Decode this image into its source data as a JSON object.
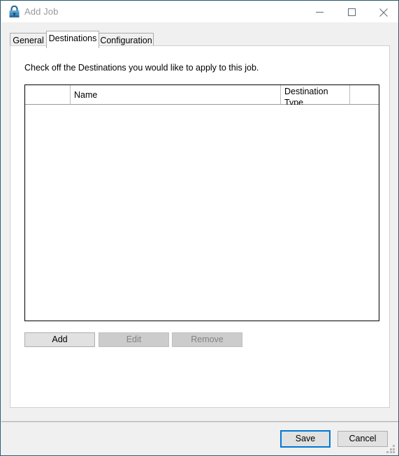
{
  "window": {
    "title": "Add Job",
    "icon": "padlock-icon",
    "accent_border": "#2b5f73",
    "controls": {
      "minimize": "minimize-icon",
      "maximize": "maximize-icon",
      "close": "close-icon"
    }
  },
  "tabs": [
    {
      "label": "General",
      "selected": false
    },
    {
      "label": "Destinations",
      "selected": true
    },
    {
      "label": "Configuration",
      "selected": false
    }
  ],
  "panel": {
    "instruction": "Check off the Destinations you would like to apply to this job.",
    "grid": {
      "columns": [
        {
          "label": "",
          "name": "checkbox-column"
        },
        {
          "label": "Name",
          "name": "name-column"
        },
        {
          "label_line1": "Destination",
          "label_line2": "Type",
          "name": "destination-type-column"
        },
        {
          "label": "",
          "name": "spacer-column"
        }
      ],
      "rows": []
    },
    "actions": [
      {
        "label": "Add",
        "enabled": true
      },
      {
        "label": "Edit",
        "enabled": false
      },
      {
        "label": "Remove",
        "enabled": false
      }
    ]
  },
  "footer": {
    "save_label": "Save",
    "cancel_label": "Cancel",
    "focus_color": "#0078d7",
    "resize_grip": "resize-grip-icon"
  }
}
